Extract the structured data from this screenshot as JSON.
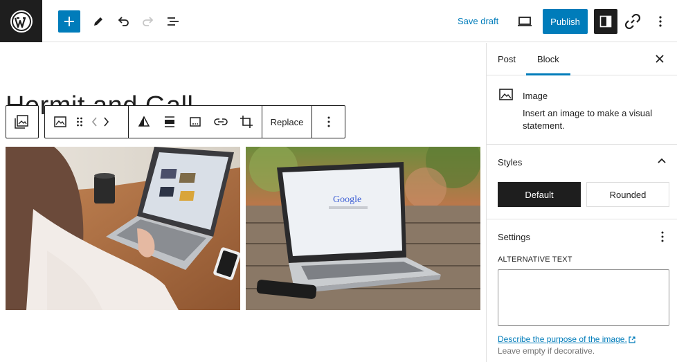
{
  "topbar": {
    "save_draft_label": "Save draft",
    "publish_label": "Publish"
  },
  "canvas": {
    "post_title": "Hermit and Gall",
    "toolbar": {
      "replace_label": "Replace"
    },
    "images": [
      {
        "name": "woman-laptop-photo"
      },
      {
        "name": "google-laptop-photo",
        "screen_text": "Google"
      }
    ]
  },
  "sidebar": {
    "tabs": [
      "Post",
      "Block"
    ],
    "active_tab": "Block",
    "block": {
      "name": "Image",
      "description": "Insert an image to make a visual statement."
    },
    "styles": {
      "title": "Styles",
      "options": [
        "Default",
        "Rounded"
      ],
      "selected": "Default"
    },
    "settings": {
      "title": "Settings",
      "alt_text_label": "ALTERNATIVE TEXT",
      "alt_text_value": "",
      "alt_link": "Describe the purpose of the image.",
      "alt_help": "Leave empty if decorative."
    }
  },
  "colors": {
    "accent": "#007cba",
    "dark": "#1e1e1e",
    "border": "#e0e0e0"
  }
}
